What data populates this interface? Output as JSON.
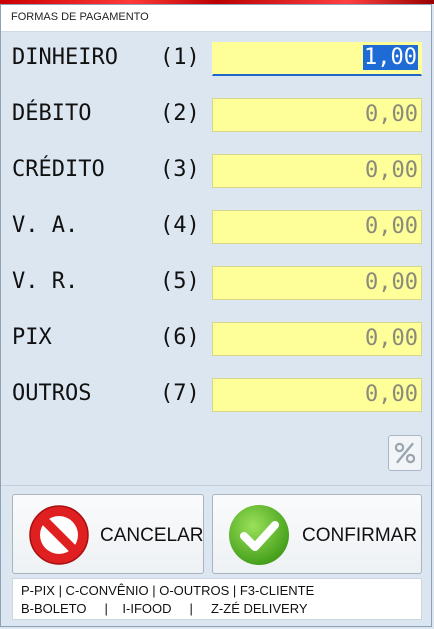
{
  "window": {
    "title": "FORMAS DE PAGAMENTO"
  },
  "payments": [
    {
      "label": "DINHEIRO",
      "key": "(1)",
      "value": "1,00"
    },
    {
      "label": "DÉBITO",
      "key": "(2)",
      "value": "0,00"
    },
    {
      "label": "CRÉDITO",
      "key": "(3)",
      "value": "0,00"
    },
    {
      "label": "V. A.",
      "key": "(4)",
      "value": "0,00"
    },
    {
      "label": "V. R.",
      "key": "(5)",
      "value": "0,00"
    },
    {
      "label": "PIX",
      "key": "(6)",
      "value": "0,00"
    },
    {
      "label": "OUTROS",
      "key": "(7)",
      "value": "0,00"
    }
  ],
  "percent_button": {
    "icon": "percent-icon"
  },
  "buttons": {
    "cancel": {
      "label": "CANCELAR",
      "icon": "prohibited-icon",
      "color": "#e02020"
    },
    "confirm": {
      "label": "CONFIRMAR",
      "icon": "checkmark-icon",
      "color": "#5cb82a"
    }
  },
  "shortcuts": {
    "line1": "P-PIX | C-CONVÊNIO | O-OUTROS | F3-CLIENTE",
    "line2": "B-BOLETO     |    I-IFOOD     |     Z-ZÉ DELIVERY"
  },
  "colors": {
    "field_bg": "#ffff99",
    "selection": "#1e6bd6",
    "window_bg": "#dce6f1"
  }
}
